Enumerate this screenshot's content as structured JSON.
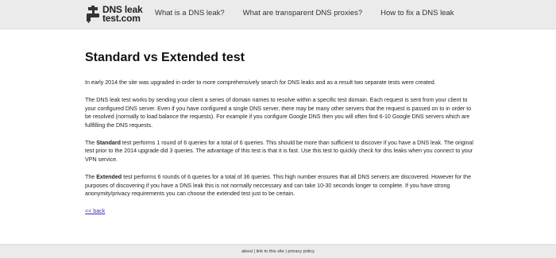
{
  "header": {
    "logo_line1": "DNS leak",
    "logo_line2": "test.com",
    "nav": [
      "What is a DNS leak?",
      "What are transparent DNS proxies?",
      "How to fix a DNS leak"
    ]
  },
  "main": {
    "title": "Standard vs Extended test",
    "p1": "In early 2014 the site was upgraded in order to more comprehensively search for DNS leaks and as a result two separate tests were created.",
    "p2": "The DNS leak test works by sending your client a series of domain names to resolve within a specific test domain. Each request is sent from your client to your configured DNS server. Even if you have configured a single DNS server, there may be many other servers that the request is passed on to in order to be resolved (normally to load balance the requests). For example if you configure Google DNS then you will often find 6-10 Google DNS servers which are fullfilling the DNS requests.",
    "p3_bold": "Standard",
    "p3_pre": "The ",
    "p3_rest": " test performs 1 round of 6 queries for a total of 6 queries. This should be more than sufficient to discover if you have a DNS leak. The original test prior to the 2014 upgrade did 3 queries. The advantage of this test is that it is fast. Use this test to quickly check for dns leaks when you connect to your VPN service.",
    "p4_pre": "The ",
    "p4_bold": "Extended",
    "p4_rest": " test performs 6 rounds of 6 queries for a total of 36 queries. This high number ensures that all DNS servers are discovered. However for the purposes of discovering if you have a DNS leak this is not normally neccessary and can take 10-30 seconds longer to complete. If you have strong anonymity/privacy requirements you can choose the extended test just to be certain.",
    "back_link": "<< back"
  },
  "footer": {
    "about": "about",
    "sep1": " | ",
    "link": "link to this site",
    "sep2": " | ",
    "privacy": "privacy policy"
  }
}
